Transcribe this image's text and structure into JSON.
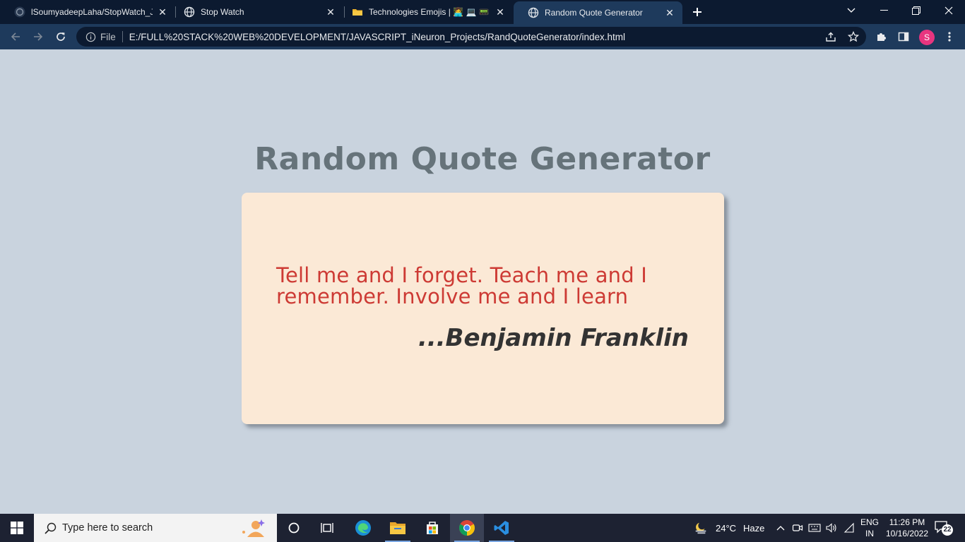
{
  "browser": {
    "tabs": [
      {
        "title": "lSoumyadeepLaha/StopWatch_JS",
        "icon": "github-icon"
      },
      {
        "title": "Stop Watch",
        "icon": "globe-icon"
      },
      {
        "title": "Technologies Emojis | 👩‍💻 💻 📟 ⚒️",
        "icon": "folder-icon"
      },
      {
        "title": "Random Quote Generator",
        "icon": "globe-icon"
      }
    ],
    "omnibox": {
      "scheme_label": "File",
      "url": "E:/FULL%20STACK%20WEB%20DEVELOPMENT/JAVASCRIPT_iNeuron_Projects/RandQuoteGenerator/index.html"
    },
    "profile_initial": "S"
  },
  "page": {
    "heading": "Random Quote Generator",
    "quote": "Tell me and I forget. Teach me and I remember. Involve me and I learn",
    "author": "...Benjamin Franklin",
    "colors": {
      "background": "#c9d3de",
      "card": "#fbe9d6",
      "quote": "#cd3a34",
      "heading": "#66737a"
    }
  },
  "taskbar": {
    "search_placeholder": "Type here to search",
    "weather_temp": "24°C",
    "weather_desc": "Haze",
    "lang_top": "ENG",
    "lang_bottom": "IN",
    "time": "11:26 PM",
    "date": "10/16/2022",
    "notification_count": "22"
  }
}
